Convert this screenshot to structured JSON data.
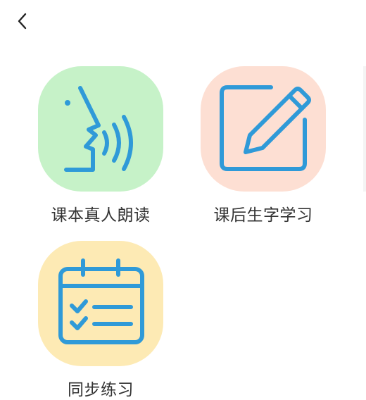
{
  "colors": {
    "icon_stroke": "#2f9ad8",
    "reading_bg": "#c6f2c8",
    "writing_bg": "#fddfd3",
    "practice_bg": "#fdeab4",
    "label": "#333333"
  },
  "nav": {
    "back_icon": "chevron-left-icon"
  },
  "tiles": [
    {
      "label": "课本真人朗读",
      "icon": "speaking-head-icon"
    },
    {
      "label": "课后生字学习",
      "icon": "pencil-edit-icon"
    },
    {
      "label": "同步练习",
      "icon": "calendar-checklist-icon"
    }
  ]
}
